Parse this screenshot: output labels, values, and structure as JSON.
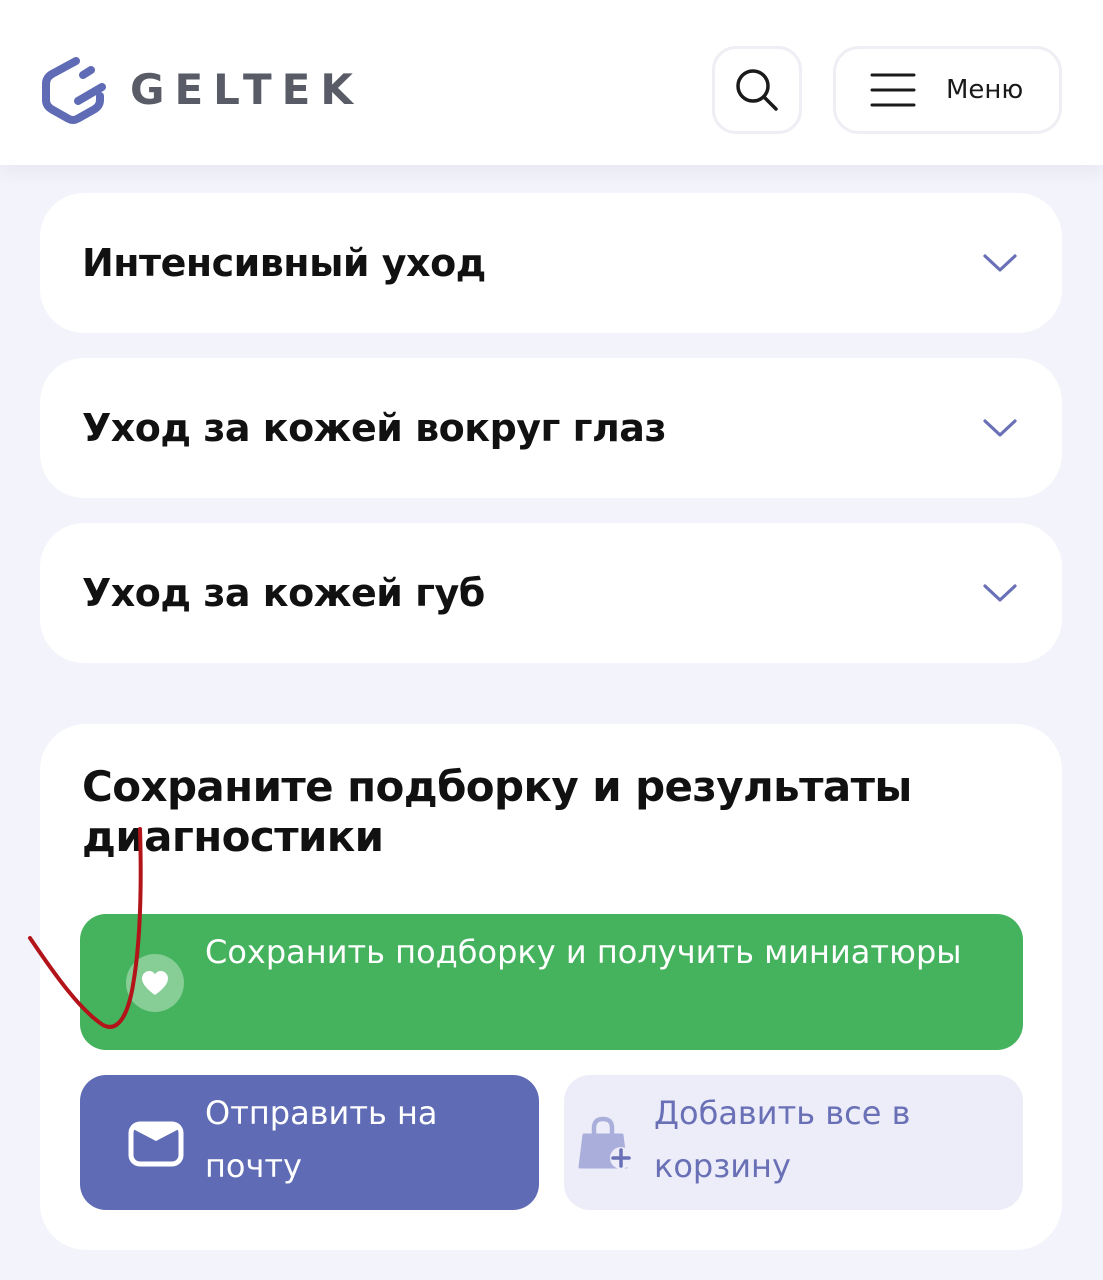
{
  "header": {
    "logo_text": "GELTEK",
    "logo_icon": "geltek-hexagon-logo",
    "search_icon": "search-icon",
    "menu_label": "Меню",
    "menu_icon": "hamburger-icon"
  },
  "accordion": {
    "items": [
      {
        "title": "Интенсивный уход",
        "icon": "chevron-down-icon"
      },
      {
        "title": "Уход за кожей вокруг глаз",
        "icon": "chevron-down-icon"
      },
      {
        "title": "Уход за кожей губ",
        "icon": "chevron-down-icon"
      }
    ]
  },
  "save_section": {
    "title": "Сохраните подборку и результаты диагностики",
    "save_button": {
      "label": "Сохранить подборку и получить миниатюры",
      "icon": "heart-icon"
    },
    "email_button": {
      "label": "Отправить на почту",
      "icon": "envelope-icon"
    },
    "cart_button": {
      "label": "Добавить все в корзину",
      "icon": "bag-plus-icon"
    }
  },
  "colors": {
    "page_background": "#f3f3fb",
    "logo_accent": "#5f6cb5",
    "logo_text": "#595b66",
    "chevron": "#6a70b6",
    "save_button": "#45b25e",
    "email_button": "#5f6cb5",
    "cart_button_bg": "#ecedf9",
    "cart_button_text": "#6a70b6",
    "annotation_stroke": "#b3141a"
  }
}
